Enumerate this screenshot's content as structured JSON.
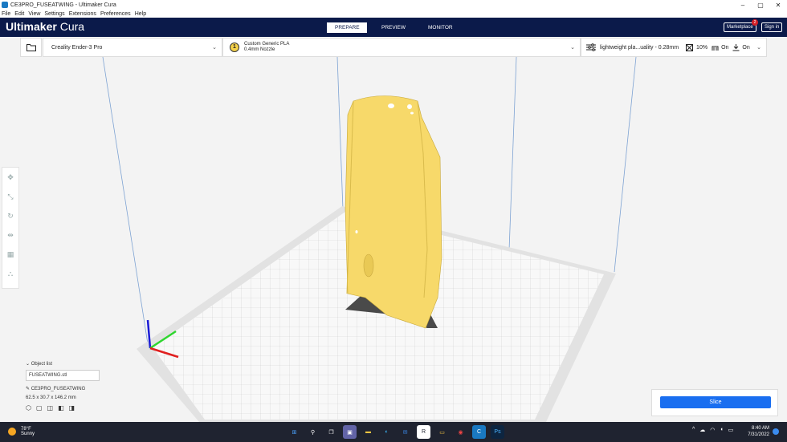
{
  "window": {
    "title": "CE3PRO_FUSEATWING - Ultimaker Cura",
    "controls": [
      "–",
      "▢",
      "✕"
    ]
  },
  "menu": [
    "File",
    "Edit",
    "View",
    "Settings",
    "Extensions",
    "Preferences",
    "Help"
  ],
  "header": {
    "brand_bold": "Ultimaker",
    "brand_light": " Cura",
    "stages": [
      "PREPARE",
      "PREVIEW",
      "MONITOR"
    ],
    "active_stage": "PREPARE",
    "marketplace": "Marketplace",
    "marketplace_badge": "2",
    "signin": "Sign in"
  },
  "toolbar": {
    "machine": "Creality Ender-3 Pro",
    "material_slot": "1",
    "material_name": "Custom Generic PLA",
    "nozzle": "0.4mm Nozzle",
    "profile": "lightweight pla...uality - 0.28mm",
    "infill": "10%",
    "support": "On",
    "adhesion": "On"
  },
  "object_list": {
    "header": "Object list",
    "item": "FUSEATWING.stl",
    "job_name": "CE3PRO_FUSEATWING",
    "dimensions": "62.5 x 30.7 x 146.2 mm"
  },
  "slice": {
    "button": "Slice"
  },
  "taskbar": {
    "temperature": "78°F",
    "condition": "Sunny",
    "time": "8:40 AM",
    "date": "7/31/2022"
  },
  "colors": {
    "header_bg": "#0b1a4a",
    "model": "#f7d96a",
    "slice_button": "#196ef0"
  }
}
